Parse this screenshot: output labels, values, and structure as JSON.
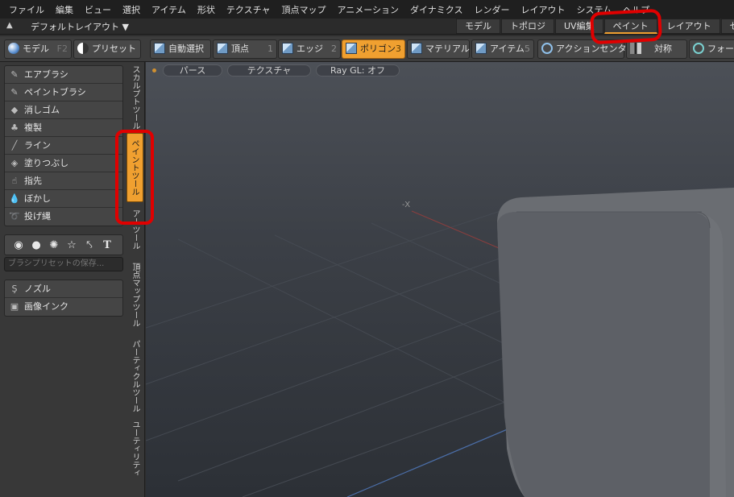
{
  "menubar": [
    "ファイル",
    "編集",
    "ビュー",
    "選択",
    "アイテム",
    "形状",
    "テクスチャ",
    "頂点マップ",
    "アニメーション",
    "ダイナミクス",
    "レンダー",
    "レイアウト",
    "システム",
    "ヘルプ"
  ],
  "layout": {
    "name": "デフォルトレイアウト ▼",
    "tabs": [
      "モデル",
      "トポロジ",
      "UV編集",
      "ペイント",
      "レイアウト",
      "セッ"
    ]
  },
  "toolbar": {
    "model": "モデル",
    "model_key": "F2",
    "preset": "プリセット",
    "auto_select": "自動選択",
    "vertex": "頂点",
    "vertex_key": "1",
    "edge": "エッジ",
    "edge_key": "2",
    "polygon": "ポリゴン",
    "polygon_key": "3",
    "material": "マテリアル",
    "item": "アイテム",
    "item_key": "5",
    "action_center": "アクションセンター",
    "symmetry": "対称",
    "falloff": "フォール"
  },
  "paint_tools": [
    {
      "icon": "airbrush-icon",
      "label": "エアブラシ"
    },
    {
      "icon": "paintbrush-icon",
      "label": "ペイントブラシ"
    },
    {
      "icon": "eraser-icon",
      "label": "消しゴム"
    },
    {
      "icon": "clone-icon",
      "label": "複製"
    },
    {
      "icon": "line-icon",
      "label": "ライン"
    },
    {
      "icon": "fill-icon",
      "label": "塗りつぶし"
    },
    {
      "icon": "smudge-icon",
      "label": "指先"
    },
    {
      "icon": "blur-icon",
      "label": "ぼかし"
    },
    {
      "icon": "lasso-icon",
      "label": "投げ縄"
    }
  ],
  "brush_preset_placeholder": "ブラシプリセットの保存...",
  "nozzle_tools": [
    {
      "icon": "nozzle-icon",
      "label": "ノズル"
    },
    {
      "icon": "image-ink-icon",
      "label": "画像インク"
    }
  ],
  "vertical_tabs": [
    "スカルプトツール",
    "ペイントツール",
    "アーツール",
    "頂点マップツール",
    "パーティクルツール",
    "ユーティリティ"
  ],
  "viewport": {
    "buttons": [
      "パース",
      "テクスチャ",
      "Ray GL: オフ"
    ],
    "axis_label": "-X"
  },
  "colors": {
    "accent": "#f0a030",
    "annotation": "#e00000"
  }
}
